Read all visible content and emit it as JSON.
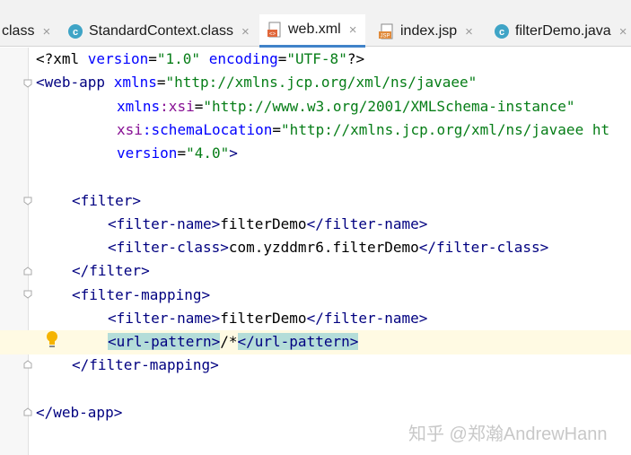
{
  "tabs": [
    {
      "label": "class",
      "icon": "partial-tab"
    },
    {
      "label": "StandardContext.class",
      "icon": "class-file-icon"
    },
    {
      "label": "web.xml",
      "icon": "xml-file-icon",
      "active": true
    },
    {
      "label": "index.jsp",
      "icon": "jsp-file-icon"
    },
    {
      "label": "filterDemo.java",
      "icon": "class-file-icon"
    }
  ],
  "close_glyph": "×",
  "code": {
    "l1": {
      "a": "<?xml ",
      "b": "version",
      "c": "=",
      "d": "\"1.0\"",
      "e": " ",
      "f": "encoding",
      "g": "=",
      "h": "\"UTF-8\"",
      "i": "?>"
    },
    "l2": {
      "a": "<web-app ",
      "b": "xmlns",
      "c": "=",
      "d": "\"http://xmlns.jcp.org/xml/ns/javaee\""
    },
    "l3": {
      "a": "xmlns",
      "b": ":xsi",
      "c": "=",
      "d": "\"http://www.w3.org/2001/XMLSchema-instance\""
    },
    "l4": {
      "a": "xsi",
      "b": ":schemaLocation",
      "c": "=",
      "d": "\"http://xmlns.jcp.org/xml/ns/javaee ht"
    },
    "l5": {
      "a": "version",
      "b": "=",
      "c": "\"4.0\"",
      "d": ">"
    },
    "l7": {
      "a": "<filter>"
    },
    "l8": {
      "a": "<filter-name>",
      "b": "filterDemo",
      "c": "</filter-name>"
    },
    "l9": {
      "a": "<filter-class>",
      "b": "com.yzddmr6.filterDemo",
      "c": "</filter-class>"
    },
    "l10": {
      "a": "</filter>"
    },
    "l11": {
      "a": "<filter-mapping>"
    },
    "l12": {
      "a": "<filter-name>",
      "b": "filterDemo",
      "c": "</filter-name>"
    },
    "l13": {
      "a": "<url-pattern>",
      "b": "/*",
      "c": "</url-pattern>"
    },
    "l14": {
      "a": "</filter-mapping>"
    },
    "l16": {
      "a": "</web-app>"
    }
  },
  "watermark": "知乎 @郑瀚AndrewHann",
  "colors": {
    "tag": "#000080",
    "attribute": "#0000ff",
    "value": "#067d17",
    "namespace": "#871094",
    "active_tab_underline": "#4083c9",
    "caret_line": "#fffae3",
    "bracket_match": "#b4ddd9"
  }
}
